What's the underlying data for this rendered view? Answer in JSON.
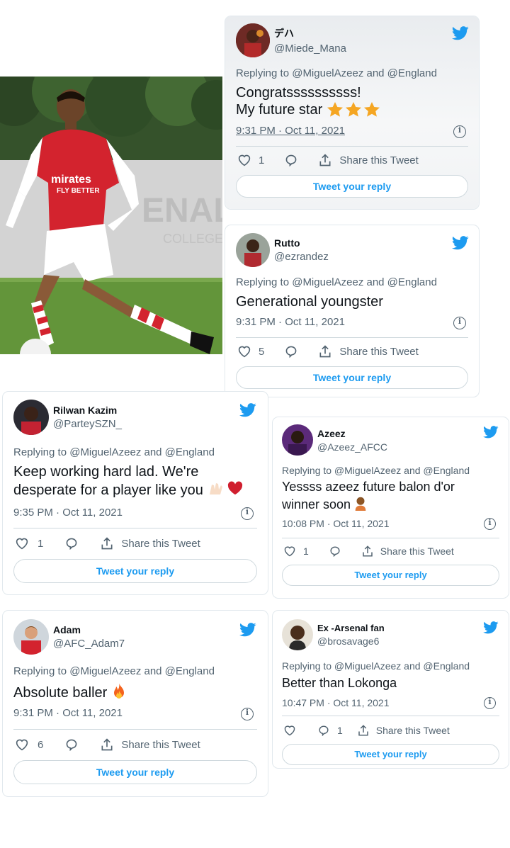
{
  "colors": {
    "twitter_blue": "#1d9bf0",
    "text": "#0f1419",
    "muted": "#536471",
    "heart": "#d01e2e",
    "star": "#f5a623"
  },
  "tweets": [
    {
      "display_name": "デハ",
      "handle": "@Miede_Mana",
      "replying": "Replying to @MiguelAzeez and @England",
      "text_line1": "Congratssssssssss!",
      "text_line2": "My future star",
      "emoji": "star-emoji x3",
      "timestamp": "9:31 PM · Oct 11, 2021",
      "likes": "1",
      "replies": "",
      "share": "Share this Tweet",
      "reply_button": "Tweet your reply"
    },
    {
      "display_name": "Rutto",
      "handle": "@ezrandez",
      "replying": "Replying to @MiguelAzeez and @England",
      "text_line1": "Generational youngster",
      "timestamp": "9:31 PM · Oct 11, 2021",
      "likes": "5",
      "replies": "",
      "share": "Share this Tweet",
      "reply_button": "Tweet your reply"
    },
    {
      "display_name": "Rilwan Kazim",
      "handle": "@ParteySZN_",
      "replying": "Replying to @MiguelAzeez and @England",
      "text_line1": "Keep working hard lad. We're",
      "text_line2": "desperate for a player like you",
      "emoji": "raised-hands-emoji, red-heart-emoji",
      "timestamp": "9:35 PM · Oct 11, 2021",
      "likes": "1",
      "replies": "",
      "share": "Share this Tweet",
      "reply_button": "Tweet your reply"
    },
    {
      "display_name": "Azeez",
      "handle": "@Azeez_AFCC",
      "replying": "Replying to @MiguelAzeez and @England",
      "text_line1": "Yessss azeez future balon d'or",
      "text_line2": "winner soon",
      "emoji": "person-emoji",
      "timestamp": "10:08 PM · Oct 11, 2021",
      "likes": "1",
      "replies": "",
      "share": "Share this Tweet",
      "reply_button": "Tweet your reply"
    },
    {
      "display_name": "Adam",
      "handle": "@AFC_Adam7",
      "replying": "Replying to @MiguelAzeez and @England",
      "text_line1": "Absolute baller",
      "emoji": "fire-emoji",
      "timestamp": "9:31 PM · Oct 11, 2021",
      "likes": "6",
      "replies": "",
      "share": "Share this Tweet",
      "reply_button": "Tweet your reply"
    },
    {
      "display_name": "Ex -Arsenal fan",
      "handle": "@brosavage6",
      "replying": "Replying to @MiguelAzeez and @England",
      "text_line1": "Better than Lokonga",
      "timestamp": "10:47 PM · Oct 11, 2021",
      "likes": "",
      "replies": "1",
      "share": "Share this Tweet",
      "reply_button": "Tweet your reply"
    }
  ],
  "photo": {
    "description_icon": "footballer-photo",
    "shirt_text": "Emirates FLY BETTER"
  }
}
